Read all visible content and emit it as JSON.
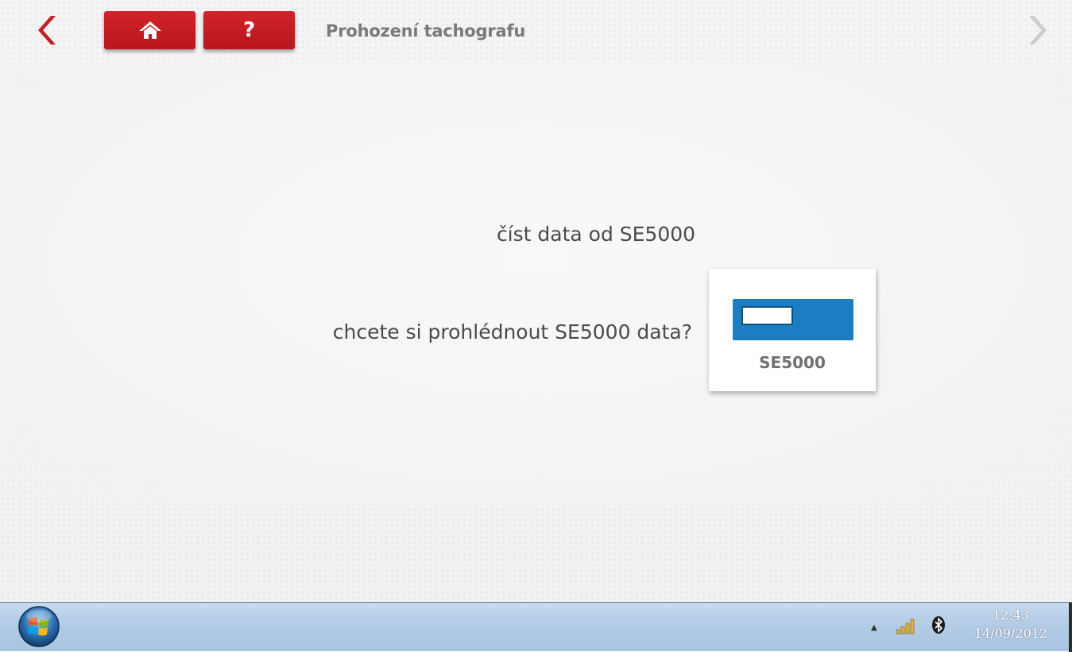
{
  "header": {
    "title": "Prohození tachografu",
    "help_label": "?"
  },
  "main": {
    "message_line1": "číst data od SE5000",
    "message_line2": "chcete si prohlédnout SE5000 data?",
    "device_option": {
      "label": "SE5000",
      "color": "#1b7ec2"
    }
  },
  "icons": {
    "back": "chevron-left-icon",
    "home": "home-icon",
    "help": "help-icon",
    "forward": "chevron-right-icon"
  },
  "colors": {
    "accent_red": "#c81d25",
    "title_gray": "#7a7a7a",
    "device_blue": "#1b7ec2"
  },
  "taskbar": {
    "time": "12:43",
    "date": "14/09/2012"
  }
}
